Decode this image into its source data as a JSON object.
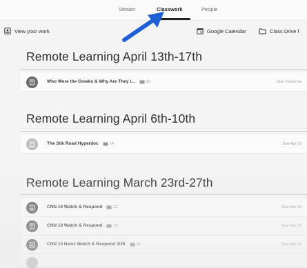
{
  "tabs": [
    {
      "label": "Stream",
      "active": false
    },
    {
      "label": "Classwork",
      "active": true
    },
    {
      "label": "People",
      "active": false
    }
  ],
  "toolbar": {
    "view_work": "View your work",
    "google_calendar": "Google Calendar",
    "class_drive": "Class Drive f"
  },
  "sections": [
    {
      "title": "Remote Learning April 13th-17th",
      "items": [
        {
          "title": "Who Were the Greeks & Why Are They I...",
          "count": "10",
          "due": "Due Tomorrow",
          "icon": "assignment-icon"
        }
      ]
    },
    {
      "title": "Remote Learning April 6th-10th",
      "items": [
        {
          "title": "The Silk Road Hyperdoc",
          "count": "14",
          "due": "Due Apr 13",
          "icon": "assignment-icon"
        }
      ]
    },
    {
      "title": "Remote Learning March 23rd-27th",
      "items": [
        {
          "title": "CNN 10 Watch & Respond",
          "count": "22",
          "due": "Due Mar 30",
          "icon": "assignment-icon"
        },
        {
          "title": "CNN 10 Watch & Respond",
          "count": "24",
          "due": "Due Mar 27",
          "icon": "assignment-icon"
        },
        {
          "title": "CNN 10 News Watch & Respond 3/26",
          "count": "38",
          "due": "Due Mar 26",
          "icon": "assignment-icon"
        }
      ]
    }
  ],
  "colors": {
    "accent_arrow": "#1e5fd6",
    "active_tab": "#222222",
    "avatar": "#6a6a6a"
  }
}
